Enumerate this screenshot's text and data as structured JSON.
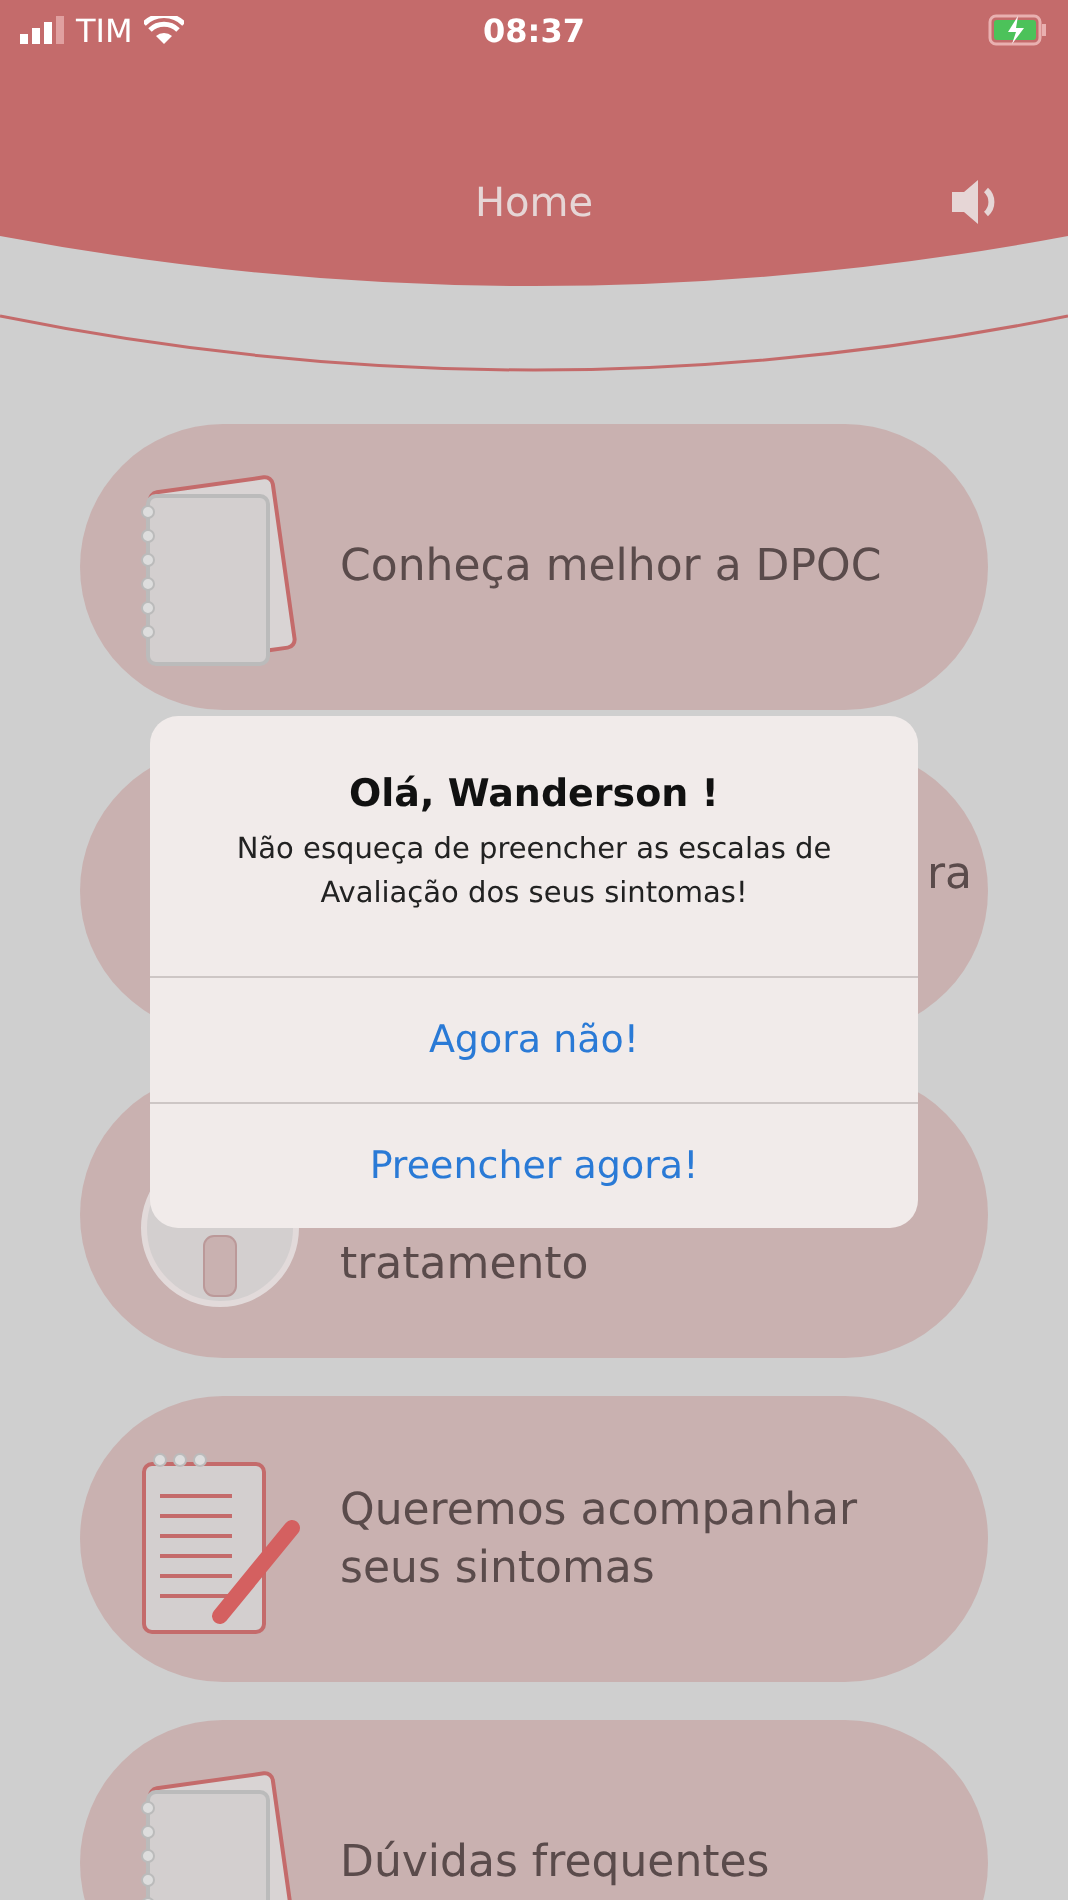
{
  "status_bar": {
    "carrier": "TIM",
    "time": "08:37"
  },
  "header": {
    "title": "Home"
  },
  "menu": [
    {
      "label": "Conheça melhor a DPOC",
      "kind": "notebook"
    },
    {
      "label": "ra",
      "kind": "hidden"
    },
    {
      "label": "tratamento",
      "kind": "medicine"
    },
    {
      "label": "Queremos acompanhar seus sintomas",
      "kind": "notepad"
    },
    {
      "label": "Dúvidas frequentes",
      "kind": "notebook"
    }
  ],
  "alert": {
    "title": "Olá, Wanderson !",
    "message": "Não esqueça de preencher as escalas de Avaliação dos seus sintomas!",
    "buttons": [
      "Agora não!",
      "Preencher agora!"
    ]
  }
}
